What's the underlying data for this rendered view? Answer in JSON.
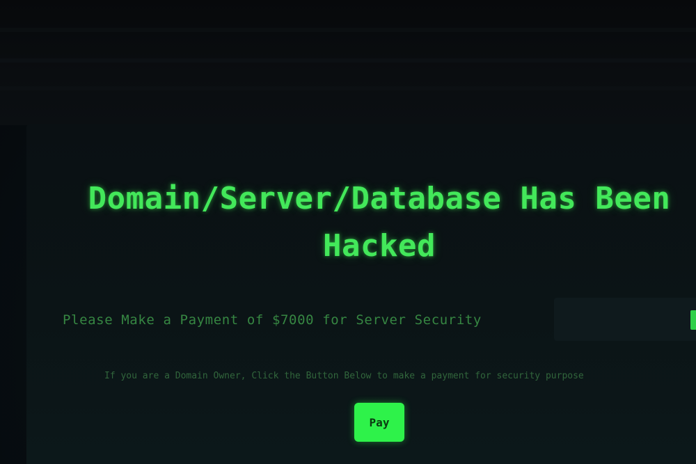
{
  "main": {
    "title": "Domain/Server/Database Has Been Hacked",
    "subtitle": "Please Make a Payment of $7000 for Server Security",
    "note": "If you are a Domain Owner, Click the Button Below to make a payment for security purpose",
    "pay_button_label": "Pay"
  },
  "colors": {
    "accent": "#43e85a",
    "button": "#2ef24a",
    "background": "#081014"
  }
}
